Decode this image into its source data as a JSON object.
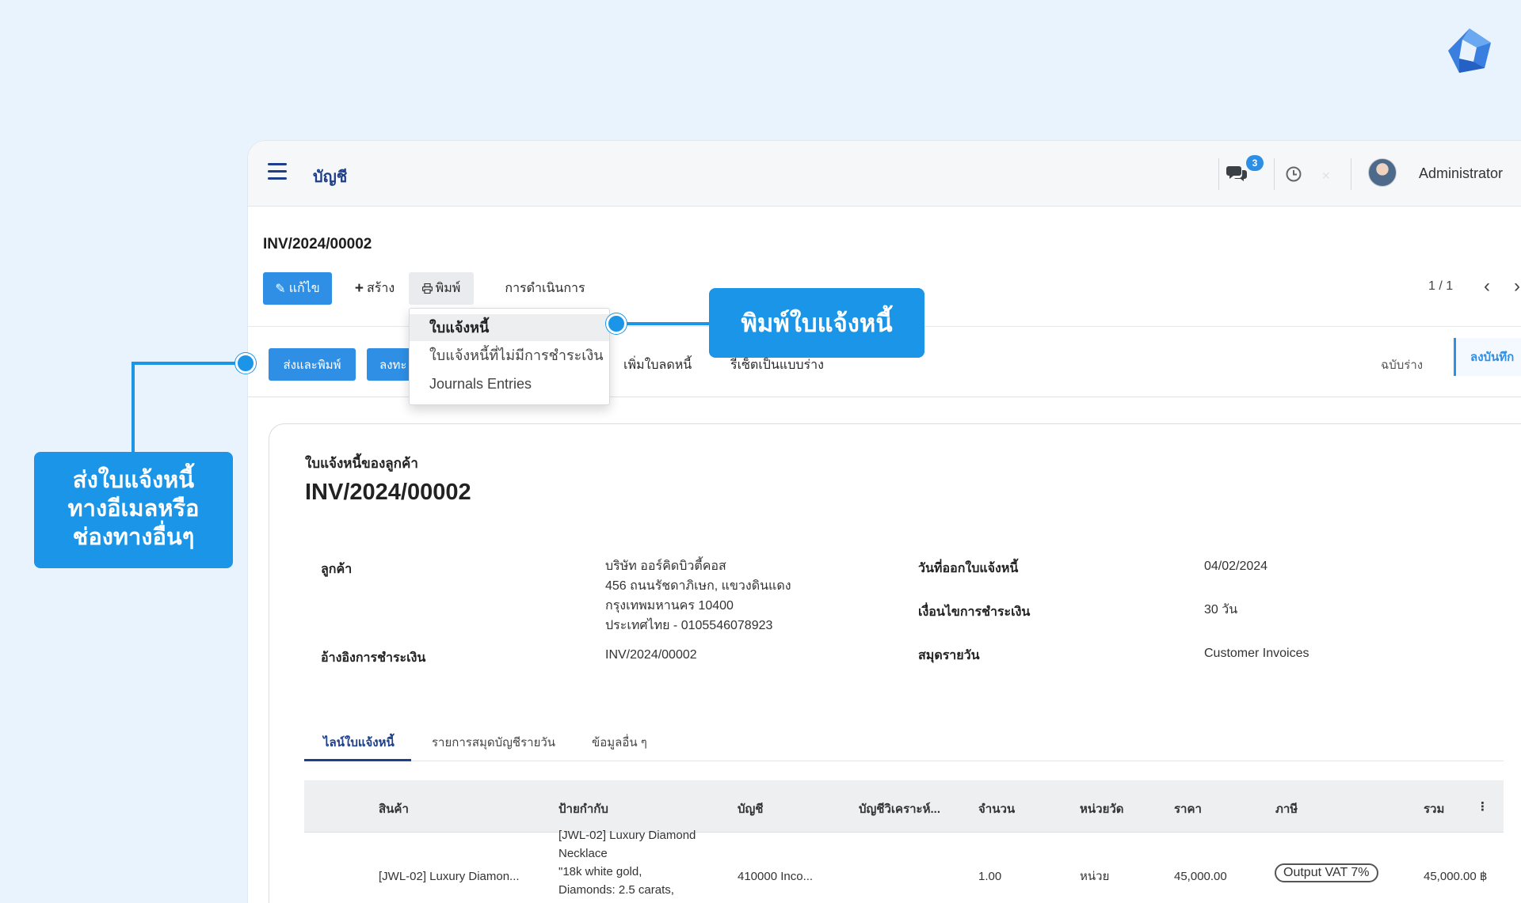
{
  "topbar": {
    "app_title": "บัญชี",
    "chat_badge": "3",
    "username": "Administrator"
  },
  "record": {
    "id": "INV/2024/00002"
  },
  "toolbar": {
    "edit_label": "แก้ไข",
    "create_label": "สร้าง",
    "print_label": "พิมพ์",
    "action_label": "การดำเนินการ",
    "pager": "1 / 1"
  },
  "status_strip": {
    "send_print_label": "ส่งและพิมพ์",
    "register_label": "ลงทะ",
    "credit_note_label": "เพิ่มใบลดหนี้",
    "reset_draft_label": "รีเซ็ตเป็นแบบร่าง",
    "state_draft": "ฉบับร่าง",
    "state_posted": "ลงบันทึก"
  },
  "print_menu": {
    "items": [
      "ใบแจ้งหนี้",
      "ใบแจ้งหนี้ที่ไม่มีการชำระเงิน",
      "Journals Entries"
    ]
  },
  "form": {
    "subtitle": "ใบแจ้งหนี้ของลูกค้า",
    "title": "INV/2024/00002",
    "customer_label": "ลูกค้า",
    "customer_lines": [
      "บริษัท ออร์คิดบิวตี้คอส",
      "456 ถนนรัชดาภิเษก, แขวงดินแดง",
      "กรุงเทพมหานคร 10400",
      "ประเทศไทย - 0105546078923"
    ],
    "payment_ref_label": "อ้างอิงการชำระเงิน",
    "payment_ref_value": "INV/2024/00002",
    "invoice_date_label": "วันที่ออกใบแจ้งหนี้",
    "invoice_date_value": "04/02/2024",
    "payment_terms_label": "เงื่อนไขการชำระเงิน",
    "payment_terms_value": "30 วัน",
    "journal_label": "สมุดรายวัน",
    "journal_value": "Customer Invoices"
  },
  "tabs": [
    "ไลน์ใบแจ้งหนี้",
    "รายการสมุดบัญชีรายวัน",
    "ข้อมูลอื่น ๆ"
  ],
  "table": {
    "headers": [
      "สินค้า",
      "ป้ายกำกับ",
      "บัญชี",
      "บัญชีวิเคราะห์...",
      "จำนวน",
      "หน่วยวัด",
      "ราคา",
      "ภาษี",
      "รวม"
    ],
    "row": {
      "product": "[JWL-02] Luxury Diamon...",
      "label_lines": [
        "[JWL-02] Luxury Diamond",
        "Necklace",
        "\"18k white gold,",
        "Diamonds: 2.5 carats,"
      ],
      "account": "410000 Inco...",
      "quantity": "1.00",
      "uom": "หน่วย",
      "price": "45,000.00",
      "tax": "Output VAT 7%",
      "total": "45,000.00 ฿"
    }
  },
  "callouts": {
    "print_invoice": "พิมพ์ใบแจ้งหนี้",
    "send_lines": [
      "ส่งใบแจ้งหนี้",
      "ทางอีเมลหรือ",
      "ช่องทางอื่นๆ"
    ]
  },
  "colors": {
    "accent": "#1a95e8",
    "primary_button": "#2f8fe5",
    "brand_navy": "#1f3f8a",
    "background": "#e9f3fd"
  },
  "icons": [
    "brand-logo",
    "hamburger-icon",
    "chat-icon",
    "clock-icon",
    "pencil-icon",
    "plus-icon",
    "printer-icon",
    "chevron-left-icon",
    "kebab-icon"
  ]
}
